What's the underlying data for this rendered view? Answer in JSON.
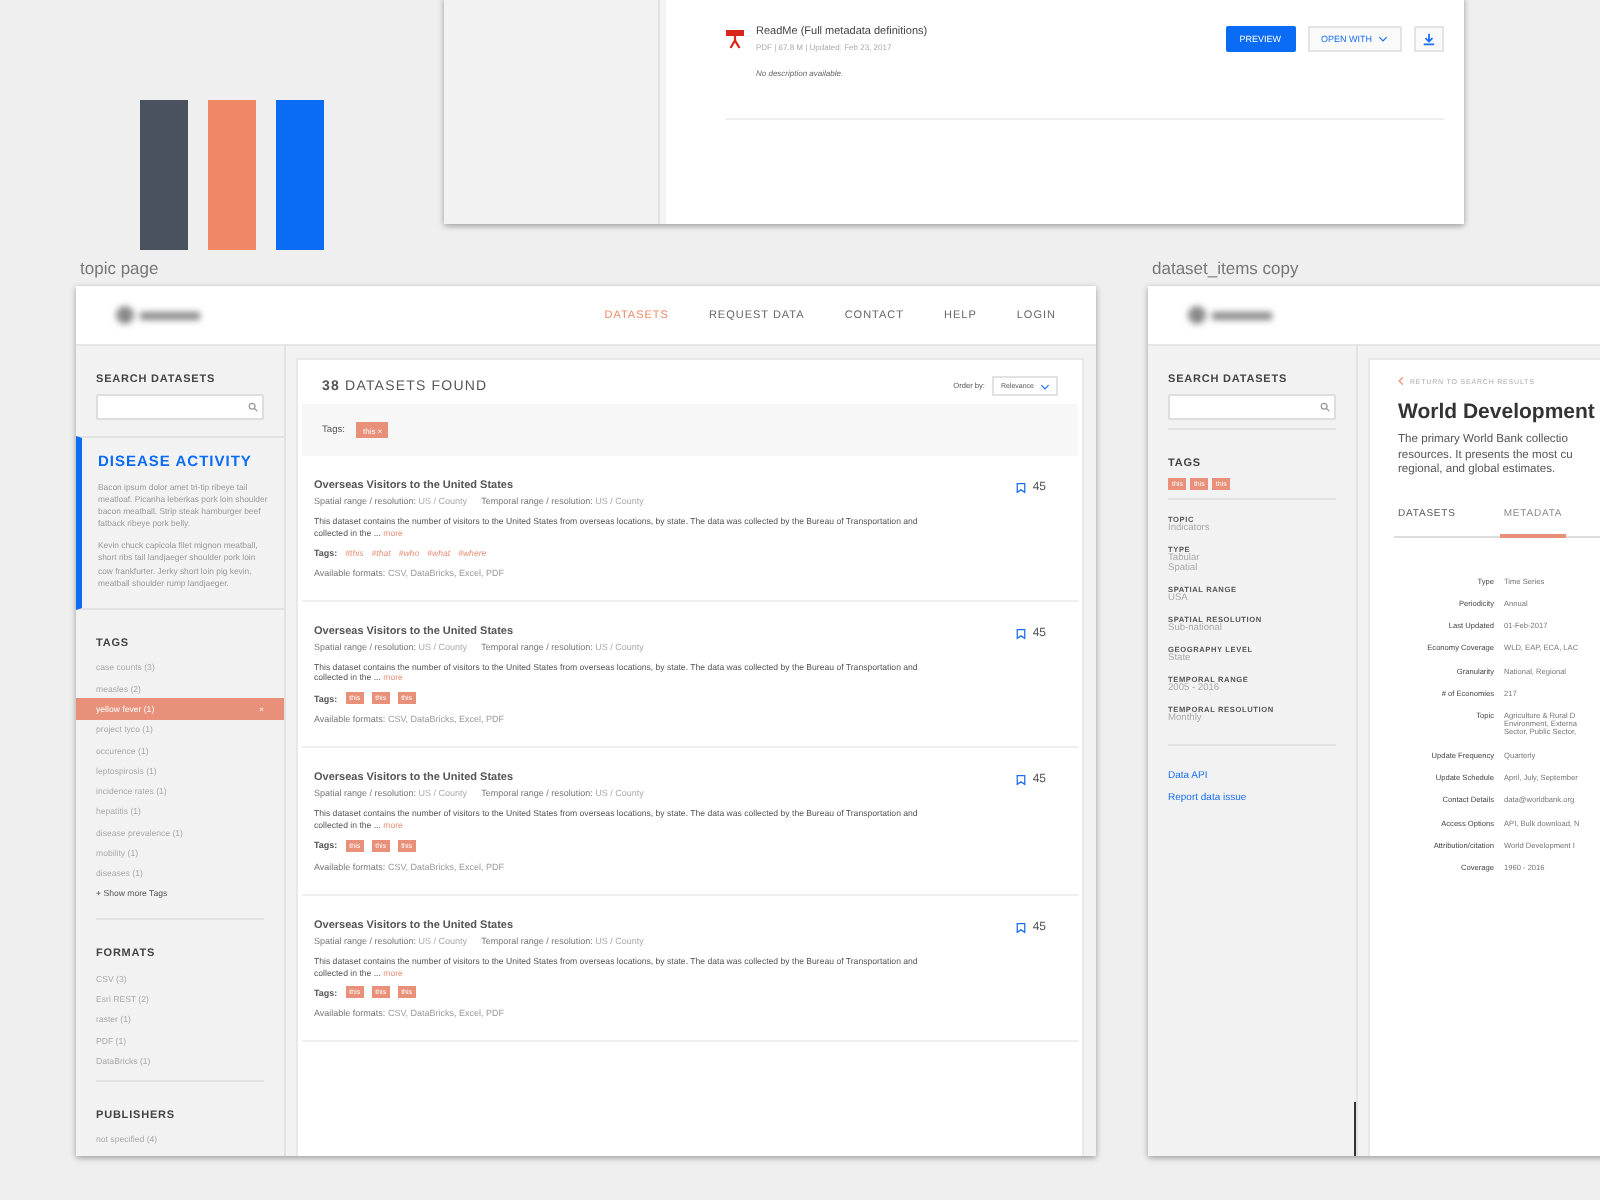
{
  "top_artboard": {
    "file": {
      "name": "ReadMe (Full metadata definitions)",
      "meta": "PDF | 67.8 M | Updated: Feb 23, 2017",
      "description": "No description available."
    },
    "preview_button": "PREVIEW",
    "open_with_button": "OPEN WITH"
  },
  "swatches": [
    {
      "color": "#4a5260"
    },
    {
      "color": "#f08866"
    },
    {
      "color": "#0a6cf5"
    }
  ],
  "topic_page": {
    "label": "topic page",
    "nav": [
      {
        "label": "DATASETS",
        "selected": true
      },
      {
        "label": "REQUEST DATA",
        "selected": false
      },
      {
        "label": "CONTACT",
        "selected": false
      },
      {
        "label": "HELP",
        "selected": false
      },
      {
        "label": "LOGIN",
        "selected": false
      }
    ],
    "search_heading": "SEARCH DATASETS",
    "topic": {
      "title": "DISEASE ACTIVITY",
      "paragraphs": [
        "Bacon ipsum dolor amet tri-tip ribeye tail meatloaf. Picanha leberkas pork loin shoulder bacon meatball. Strip steak hamburger beef fatback ribeye pork belly.",
        "Kevin chuck capicola filet mignon meatball, short ribs tail landjaeger shoulder pork loin cow frankfurter. Jerky short loin pig kevin, meatball shoulder rump landjaeger."
      ]
    },
    "tags": {
      "heading": "TAGS",
      "remove_glyph": "×",
      "items": [
        {
          "label": "case counts (3)",
          "selected": false
        },
        {
          "label": "measles (2)",
          "selected": false
        },
        {
          "label": "yellow fever (1)",
          "selected": true
        },
        {
          "label": "project tyco (1)",
          "selected": false
        },
        {
          "label": "occurence (1)",
          "selected": false
        },
        {
          "label": "leptospirosis (1)",
          "selected": false
        },
        {
          "label": "incidence rates (1)",
          "selected": false
        },
        {
          "label": "hepatitis (1)",
          "selected": false
        },
        {
          "label": "disease prevalence (1)",
          "selected": false
        },
        {
          "label": "mobility (1)",
          "selected": false
        },
        {
          "label": "diseases (1)",
          "selected": false
        }
      ],
      "show_more": "+ Show more Tags"
    },
    "formats": {
      "heading": "FORMATS",
      "items": [
        "CSV (3)",
        "Esri REST (2)",
        "raster (1)",
        "PDF (1)",
        "DataBricks (1)"
      ]
    },
    "publishers": {
      "heading": "PUBLISHERS",
      "items": [
        "not specified (4)"
      ]
    },
    "results_header": {
      "count": "38",
      "label": "DATASETS FOUND",
      "order_label": "Order by:",
      "order_value": "Relevance"
    },
    "filter": {
      "label": "Tags:",
      "tags": [
        {
          "label": "this",
          "remove": "×"
        }
      ]
    },
    "results": [
      {
        "title": "Overseas Visitors to the United States",
        "spatial_label": "Spatial range / resolution:",
        "spatial_value": "US / County",
        "temporal_label": "Temporal range / resolution:",
        "temporal_value": "US / County",
        "description": "This dataset contains the number of visitors to the United States from overseas locations, by state. The data was collected by the Bureau of Transportation and collected in the ...",
        "more": "more",
        "tags_label": "Tags:",
        "kind": "hashtag",
        "tags": [
          "#this",
          "#that",
          "#who",
          "#what",
          "#where"
        ],
        "formats_label": "Available formats:",
        "formats": "CSV, DataBricks, Excel, PDF",
        "bookmarks": "45"
      },
      {
        "title": "Overseas Visitors to the United States",
        "spatial_label": "Spatial range / resolution:",
        "spatial_value": "US / County",
        "temporal_label": "Temporal range / resolution:",
        "temporal_value": "US / County",
        "description": "This dataset contains the number of visitors to the United States from overseas locations, by state. The data was collected by the Bureau of Transportation and collected in the ...",
        "more": "more",
        "tags_label": "Tags:",
        "kind": "chip",
        "tags": [
          "this",
          "this",
          "this"
        ],
        "formats_label": "Available formats:",
        "formats": "CSV, DataBricks, Excel, PDF",
        "bookmarks": "45"
      },
      {
        "title": "Overseas Visitors to the United States",
        "spatial_label": "Spatial range / resolution:",
        "spatial_value": "US / County",
        "temporal_label": "Temporal range / resolution:",
        "temporal_value": "US / County",
        "description": "This dataset contains the number of visitors to the United States from overseas locations, by state. The data was collected by the Bureau of Transportation and collected in the ...",
        "more": "more",
        "tags_label": "Tags:",
        "kind": "chip",
        "tags": [
          "this",
          "this",
          "this"
        ],
        "formats_label": "Available formats:",
        "formats": "CSV, DataBricks, Excel, PDF",
        "bookmarks": "45"
      },
      {
        "title": "Overseas Visitors to the United States",
        "spatial_label": "Spatial range / resolution:",
        "spatial_value": "US / County",
        "temporal_label": "Temporal range / resolution:",
        "temporal_value": "US / County",
        "description": "This dataset contains the number of visitors to the United States from overseas locations, by state. The data was collected by the Bureau of Transportation and collected in the ...",
        "more": "more",
        "tags_label": "Tags:",
        "kind": "chip",
        "tags": [
          "this",
          "this",
          "this"
        ],
        "formats_label": "Available formats:",
        "formats": "CSV, DataBricks, Excel, PDF",
        "bookmarks": "45"
      }
    ]
  },
  "dataset_page": {
    "label": "dataset_items copy",
    "search_heading": "SEARCH DATASETS",
    "tags_heading": "TAGS",
    "tags": [
      "this",
      "this",
      "this"
    ],
    "facets": [
      {
        "label": "TOPIC",
        "values": [
          "Indicators"
        ]
      },
      {
        "label": "TYPE",
        "values": [
          "Tabular",
          "Spatial"
        ]
      },
      {
        "label": "SPATIAL RANGE",
        "values": [
          "USA"
        ]
      },
      {
        "label": "SPATIAL RESOLUTION",
        "values": [
          "Sub-national"
        ]
      },
      {
        "label": "GEOGRAPHY LEVEL",
        "values": [
          "State"
        ]
      },
      {
        "label": "TEMPORAL RANGE",
        "values": [
          "2005 - 2016"
        ]
      },
      {
        "label": "TEMPORAL RESOLUTION",
        "values": [
          "Monthly"
        ]
      }
    ],
    "links": [
      "Data API",
      "Report data issue"
    ],
    "back": "RETURN TO SEARCH RESULTS",
    "title": "World Development",
    "description_lines": [
      "The primary World Bank collectio",
      "resources. It presents the most cu",
      "regional, and global estimates."
    ],
    "tabs": [
      {
        "label": "DATASETS",
        "selected": false
      },
      {
        "label": "METADATA",
        "selected": true
      }
    ],
    "metadata": [
      {
        "label": "Type",
        "values": [
          "Time Series"
        ]
      },
      {
        "label": "Periodicity",
        "values": [
          "Annual"
        ]
      },
      {
        "label": "Last Updated",
        "values": [
          "01-Feb-2017"
        ]
      },
      {
        "label": "Economy Coverage",
        "values": [
          "WLD, EAP, ECA, LAC"
        ]
      },
      {
        "label": "Granularity",
        "values": [
          "National, Regional"
        ]
      },
      {
        "label": "# of Economies",
        "values": [
          "217"
        ]
      },
      {
        "label": "Topic",
        "values": [
          "Agriculture & Rural D",
          "Environment, Externa",
          "Sector, Public Sector,"
        ]
      },
      {
        "label": "Update Frequency",
        "values": [
          "Quarterly"
        ]
      },
      {
        "label": "Update Schedule",
        "values": [
          "April, July, September"
        ]
      },
      {
        "label": "Contact Details",
        "values": [
          "data@worldbank.org"
        ]
      },
      {
        "label": "Access Options",
        "values": [
          "API, Bulk download, N"
        ]
      },
      {
        "label": "Attribution/citation",
        "values": [
          "World Development I"
        ]
      },
      {
        "label": "Coverage",
        "values": [
          "1960 - 2016"
        ]
      }
    ]
  }
}
